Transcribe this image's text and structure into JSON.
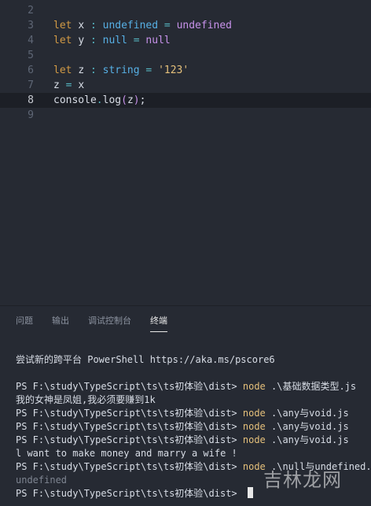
{
  "editor": {
    "lines": [
      {
        "number": "2",
        "tokens": []
      },
      {
        "number": "3",
        "tokens": [
          {
            "t": "kw",
            "v": "let "
          },
          {
            "t": "var",
            "v": "x"
          },
          {
            "t": "op",
            "v": " : "
          },
          {
            "t": "type",
            "v": "undefined"
          },
          {
            "t": "op",
            "v": " = "
          },
          {
            "t": "val",
            "v": "undefined"
          }
        ]
      },
      {
        "number": "4",
        "tokens": [
          {
            "t": "kw",
            "v": "let "
          },
          {
            "t": "var",
            "v": "y"
          },
          {
            "t": "op",
            "v": " : "
          },
          {
            "t": "type",
            "v": "null"
          },
          {
            "t": "op",
            "v": " = "
          },
          {
            "t": "val",
            "v": "null"
          }
        ]
      },
      {
        "number": "5",
        "tokens": []
      },
      {
        "number": "6",
        "tokens": [
          {
            "t": "kw",
            "v": "let "
          },
          {
            "t": "var",
            "v": "z"
          },
          {
            "t": "op",
            "v": " : "
          },
          {
            "t": "type",
            "v": "string"
          },
          {
            "t": "op",
            "v": " = "
          },
          {
            "t": "str",
            "v": "'123'"
          }
        ]
      },
      {
        "number": "7",
        "tokens": [
          {
            "t": "var",
            "v": "z"
          },
          {
            "t": "op",
            "v": " = "
          },
          {
            "t": "var",
            "v": "x"
          }
        ]
      },
      {
        "number": "8",
        "active": true,
        "tokens": [
          {
            "t": "fn",
            "v": "console"
          },
          {
            "t": "op",
            "v": "."
          },
          {
            "t": "fn",
            "v": "log"
          },
          {
            "t": "paren",
            "v": "("
          },
          {
            "t": "var",
            "v": "z"
          },
          {
            "t": "paren",
            "v": ")"
          },
          {
            "t": "var",
            "v": ";"
          }
        ]
      },
      {
        "number": "9",
        "tokens": []
      }
    ]
  },
  "panel": {
    "tabs": [
      {
        "label": "问题",
        "active": false
      },
      {
        "label": "输出",
        "active": false
      },
      {
        "label": "调试控制台",
        "active": false
      },
      {
        "label": "终端",
        "active": true
      }
    ]
  },
  "terminal": {
    "banner": "尝试新的跨平台 PowerShell https://aka.ms/pscore6",
    "lines": [
      {
        "prompt": "PS F:\\study\\TypeScript\\ts\\ts初体验\\dist> ",
        "cmd": "node",
        "args": " .\\基础数据类型.js"
      },
      {
        "text": "我的女神是凤姐,我必须要赚到1k"
      },
      {
        "prompt": "PS F:\\study\\TypeScript\\ts\\ts初体验\\dist> ",
        "cmd": "node",
        "args": " .\\any与void.js"
      },
      {
        "prompt": "PS F:\\study\\TypeScript\\ts\\ts初体验\\dist> ",
        "cmd": "node",
        "args": " .\\any与void.js"
      },
      {
        "prompt": "PS F:\\study\\TypeScript\\ts\\ts初体验\\dist> ",
        "cmd": "node",
        "args": " .\\any与void.js"
      },
      {
        "text": "l want to make money and marry a wife !"
      },
      {
        "prompt": "PS F:\\study\\TypeScript\\ts\\ts初体验\\dist> ",
        "cmd": "node",
        "args": " .\\null与undefined.js"
      },
      {
        "text": "undefined",
        "dim": true
      },
      {
        "prompt": "PS F:\\study\\TypeScript\\ts\\ts初体验\\dist> ",
        "cursor": true
      }
    ]
  },
  "watermark": "吉林龙网"
}
